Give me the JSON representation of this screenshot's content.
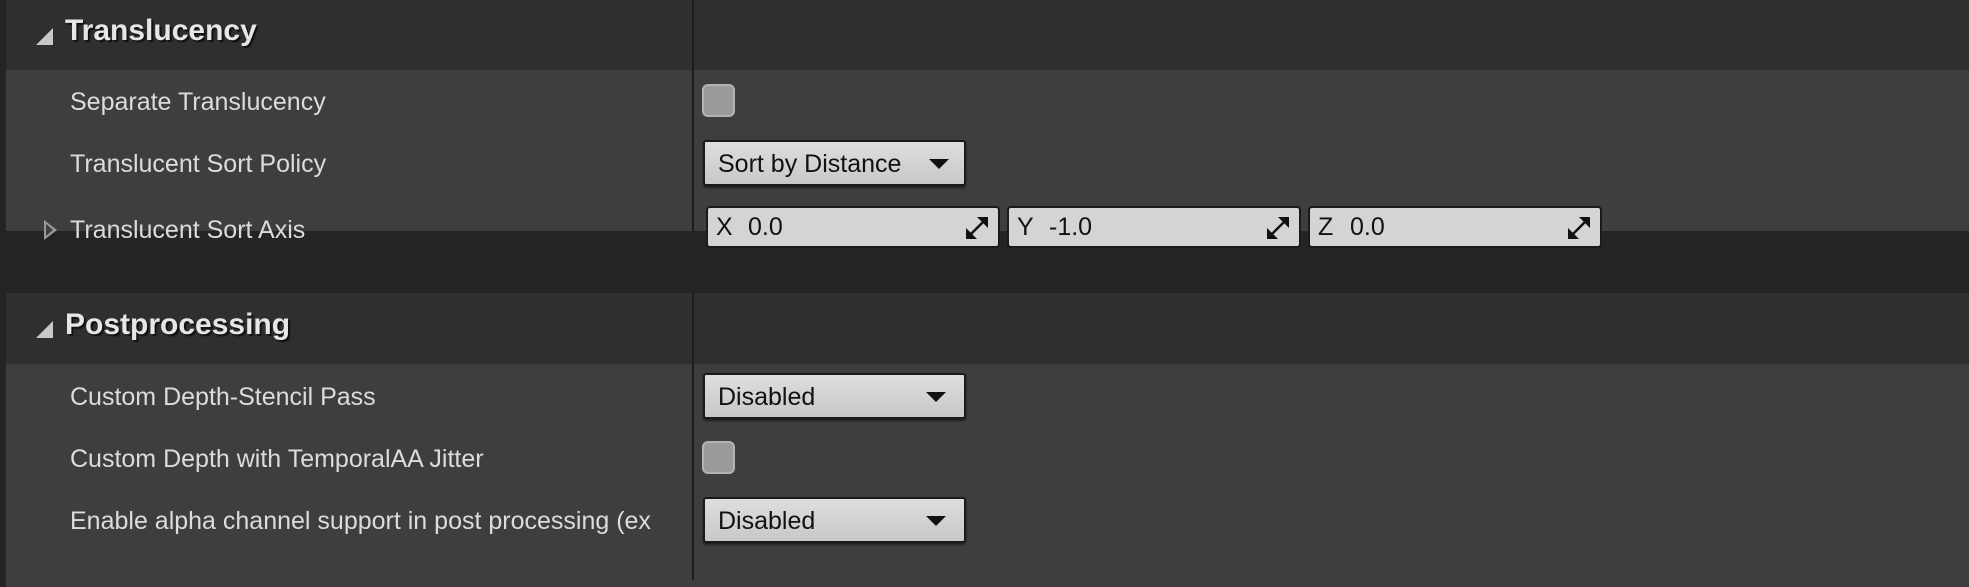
{
  "sections": {
    "translucency": {
      "title": "Translucency",
      "rows": {
        "separate_translucency": {
          "label": "Separate Translucency",
          "checked": false
        },
        "sort_policy": {
          "label": "Translucent Sort Policy",
          "value": "Sort by Distance"
        },
        "sort_axis": {
          "label": "Translucent Sort Axis",
          "x": {
            "axis": "X",
            "value": "0.0"
          },
          "y": {
            "axis": "Y",
            "value": "-1.0"
          },
          "z": {
            "axis": "Z",
            "value": "0.0"
          }
        }
      }
    },
    "postprocessing": {
      "title": "Postprocessing",
      "rows": {
        "custom_depth_stencil": {
          "label": "Custom Depth-Stencil Pass",
          "value": "Disabled"
        },
        "temporal_jitter": {
          "label": "Custom Depth with TemporalAA Jitter",
          "checked": false
        },
        "alpha_channel": {
          "label": "Enable alpha channel support in post processing (ex",
          "value": "Disabled"
        }
      }
    }
  },
  "icons": {
    "collapse": "triangle-down-right-icon",
    "expand": "triangle-right-outline-icon",
    "dropdown": "caret-down-icon",
    "spin": "drag-resize-icon"
  },
  "colors": {
    "panel_bg": "#3e3e3e",
    "header_bg": "#2f2f2f",
    "field_bg": "#d4d4d4",
    "text": "#dcdcdc"
  }
}
